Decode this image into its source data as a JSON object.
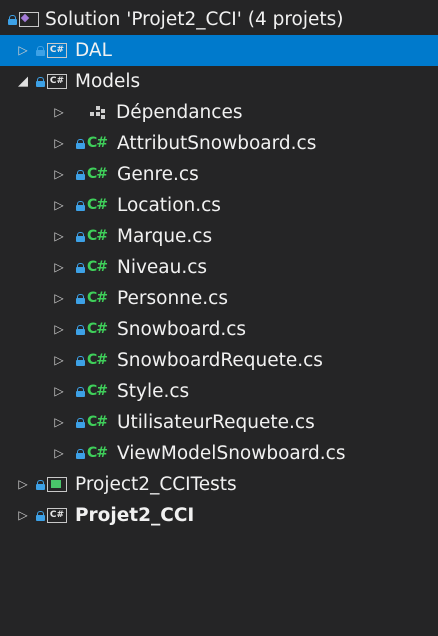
{
  "solution": {
    "label": "Solution 'Projet2_CCI' (4 projets)"
  },
  "projects": {
    "dal": {
      "label": "DAL",
      "icon_text": "C#"
    },
    "models": {
      "label": "Models",
      "icon_text": "C#"
    },
    "tests": {
      "label": "Project2_CCITests"
    },
    "main": {
      "label": "Projet2_CCI",
      "icon_text": "C#"
    }
  },
  "models_children": {
    "dependencies": "Dépendances",
    "file_icon_text": "C#",
    "files": [
      "AttributSnowboard.cs",
      "Genre.cs",
      "Location.cs",
      "Marque.cs",
      "Niveau.cs",
      "Personne.cs",
      "Snowboard.cs",
      "SnowboardRequete.cs",
      "Style.cs",
      "UtilisateurRequete.cs",
      "ViewModelSnowboard.cs"
    ]
  },
  "glyphs": {
    "collapsed": "▷",
    "expanded": "◢"
  },
  "colors": {
    "background": "#252526",
    "selection": "#007acc",
    "lock": "#3da1e6",
    "csharp_file": "#3fcf5a",
    "text": "#f1f1f1"
  },
  "icons": {
    "solution": "solution-icon",
    "project": "csharp-project-icon",
    "test_project": "test-project-icon",
    "file": "csharp-file-icon",
    "dependencies": "dependencies-icon",
    "lock": "lock-icon"
  }
}
